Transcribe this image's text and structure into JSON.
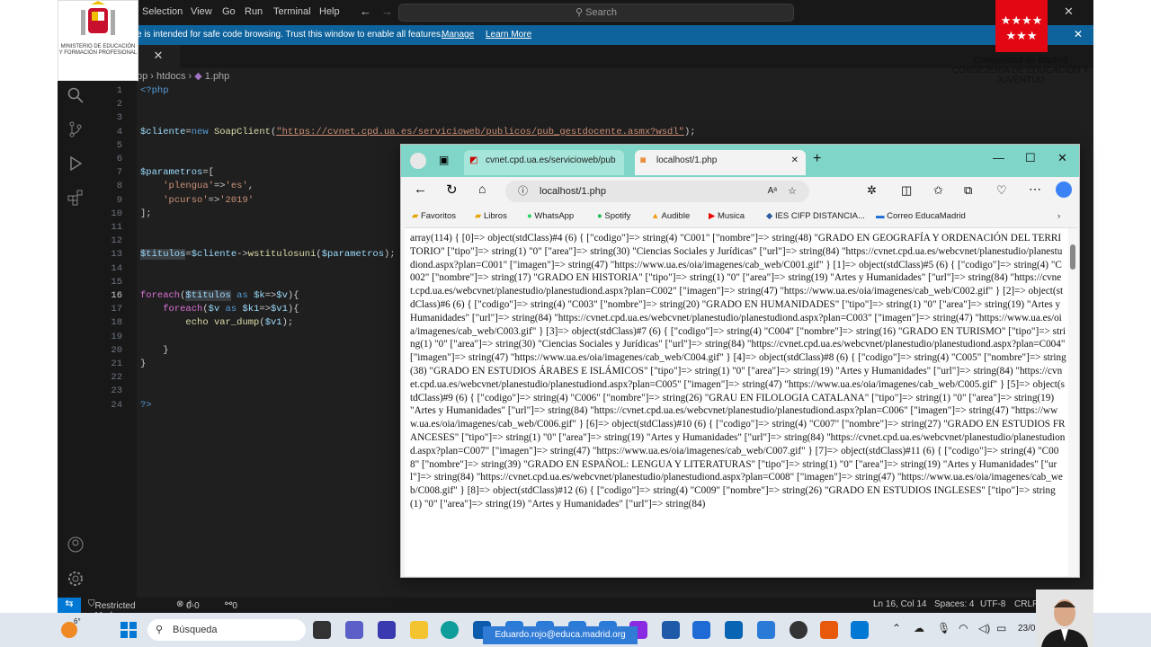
{
  "menu": [
    "Selection",
    "View",
    "Go",
    "Run",
    "Terminal",
    "Help"
  ],
  "search_placeholder": "Search",
  "banner": {
    "message": "e is intended for safe code browsing. Trust this window to enable all features.",
    "manage": "Manage",
    "learn_more": "Learn More"
  },
  "tab_close": "✕",
  "breadcrumb": [
    "pp",
    "htdocs",
    "1.php"
  ],
  "code_lines": [
    "1",
    "2",
    "3",
    "4",
    "5",
    "6",
    "7",
    "8",
    "9",
    "10",
    "11",
    "12",
    "13",
    "14",
    "15",
    "16",
    "17",
    "18",
    "19",
    "20",
    "21",
    "22",
    "23",
    "24"
  ],
  "statusbar": {
    "mode": "Restricted Mode",
    "errors": "0",
    "warnings": "0",
    "ports": "0",
    "position": "Ln 16, Col 14",
    "spaces": "Spaces: 4",
    "encoding": "UTF-8",
    "eol": "CRLF"
  },
  "logos": {
    "ministerio": "MINISTERIO DE EDUCACIÓN Y FORMACIÓN PROFESIONAL",
    "madrid_line1": "Comunidad de Madrid",
    "madrid_line2": "CONSEJERÍA DE EDUCACIÓN Y JUVENTUD"
  },
  "browser": {
    "tab1": "cvnet.cpd.ua.es/servicioweb/pub",
    "tab2": "localhost/1.php",
    "url": "localhost/1.php",
    "favorites": [
      "Favoritos",
      "Libros",
      "WhatsApp",
      "Spotify",
      "Audible",
      "Musica",
      "IES CIFP DISTANCIA...",
      "Correo EducaMadrid"
    ],
    "dump": "array(114) { [0]=> object(stdClass)#4 (6) { [\"codigo\"]=> string(4) \"C001\" [\"nombre\"]=> string(48) \"GRADO EN GEOGRAFÍA Y ORDENACIÓN DEL TERRITORIO\" [\"tipo\"]=> string(1) \"0\" [\"area\"]=> string(30) \"Ciencias Sociales y Jurídicas\" [\"url\"]=> string(84) \"https://cvnet.cpd.ua.es/webcvnet/planestudio/planestudiond.aspx?plan=C001\" [\"imagen\"]=> string(47) \"https://www.ua.es/oia/imagenes/cab_web/C001.gif\" } [1]=> object(stdClass)#5 (6) { [\"codigo\"]=> string(4) \"C002\" [\"nombre\"]=> string(17) \"GRADO EN HISTORIA\" [\"tipo\"]=> string(1) \"0\" [\"area\"]=> string(19) \"Artes y Humanidades\" [\"url\"]=> string(84) \"https://cvnet.cpd.ua.es/webcvnet/planestudio/planestudiond.aspx?plan=C002\" [\"imagen\"]=> string(47) \"https://www.ua.es/oia/imagenes/cab_web/C002.gif\" } [2]=> object(stdClass)#6 (6) { [\"codigo\"]=> string(4) \"C003\" [\"nombre\"]=> string(20) \"GRADO EN HUMANIDADES\" [\"tipo\"]=> string(1) \"0\" [\"area\"]=> string(19) \"Artes y Humanidades\" [\"url\"]=> string(84) \"https://cvnet.cpd.ua.es/webcvnet/planestudio/planestudiond.aspx?plan=C003\" [\"imagen\"]=> string(47) \"https://www.ua.es/oia/imagenes/cab_web/C003.gif\" } [3]=> object(stdClass)#7 (6) { [\"codigo\"]=> string(4) \"C004\" [\"nombre\"]=> string(16) \"GRADO EN TURISMO\" [\"tipo\"]=> string(1) \"0\" [\"area\"]=> string(30) \"Ciencias Sociales y Jurídicas\" [\"url\"]=> string(84) \"https://cvnet.cpd.ua.es/webcvnet/planestudio/planestudiond.aspx?plan=C004\" [\"imagen\"]=> string(47) \"https://www.ua.es/oia/imagenes/cab_web/C004.gif\" } [4]=> object(stdClass)#8 (6) { [\"codigo\"]=> string(4) \"C005\" [\"nombre\"]=> string(38) \"GRADO EN ESTUDIOS ÁRABES E ISLÁMICOS\" [\"tipo\"]=> string(1) \"0\" [\"area\"]=> string(19) \"Artes y Humanidades\" [\"url\"]=> string(84) \"https://cvnet.cpd.ua.es/webcvnet/planestudio/planestudiond.aspx?plan=C005\" [\"imagen\"]=> string(47) \"https://www.ua.es/oia/imagenes/cab_web/C005.gif\" } [5]=> object(stdClass)#9 (6) { [\"codigo\"]=> string(4) \"C006\" [\"nombre\"]=> string(26) \"GRAU EN FILOLOGIA CATALANA\" [\"tipo\"]=> string(1) \"0\" [\"area\"]=> string(19) \"Artes y Humanidades\" [\"url\"]=> string(84) \"https://cvnet.cpd.ua.es/webcvnet/planestudio/planestudiond.aspx?plan=C006\" [\"imagen\"]=> string(47) \"https://www.ua.es/oia/imagenes/cab_web/C006.gif\" } [6]=> object(stdClass)#10 (6) { [\"codigo\"]=> string(4) \"C007\" [\"nombre\"]=> string(27) \"GRADO EN ESTUDIOS FRANCESES\" [\"tipo\"]=> string(1) \"0\" [\"area\"]=> string(19) \"Artes y Humanidades\" [\"url\"]=> string(84) \"https://cvnet.cpd.ua.es/webcvnet/planestudio/planestudiond.aspx?plan=C007\" [\"imagen\"]=> string(47) \"https://www.ua.es/oia/imagenes/cab_web/C007.gif\" } [7]=> object(stdClass)#11 (6) { [\"codigo\"]=> string(4) \"C008\" [\"nombre\"]=> string(39) \"GRADO EN ESPAÑOL: LENGUA Y LITERATURAS\" [\"tipo\"]=> string(1) \"0\" [\"area\"]=> string(19) \"Artes y Humanidades\" [\"url\"]=> string(84) \"https://cvnet.cpd.ua.es/webcvnet/planestudio/planestudiond.aspx?plan=C008\" [\"imagen\"]=> string(47) \"https://www.ua.es/oia/imagenes/cab_web/C008.gif\" } [8]=> object(stdClass)#12 (6) { [\"codigo\"]=> string(4) \"C009\" [\"nombre\"]=> string(26) \"GRADO EN ESTUDIOS INGLESES\" [\"tipo\"]=> string(1) \"0\" [\"area\"]=> string(19) \"Artes y Humanidades\" [\"url\"]=> string(84)"
  },
  "taskbar": {
    "search": "Búsqueda",
    "weather": "6°",
    "email": "Eduardo.rojo@educa.madrid.org",
    "date": "23/0"
  }
}
